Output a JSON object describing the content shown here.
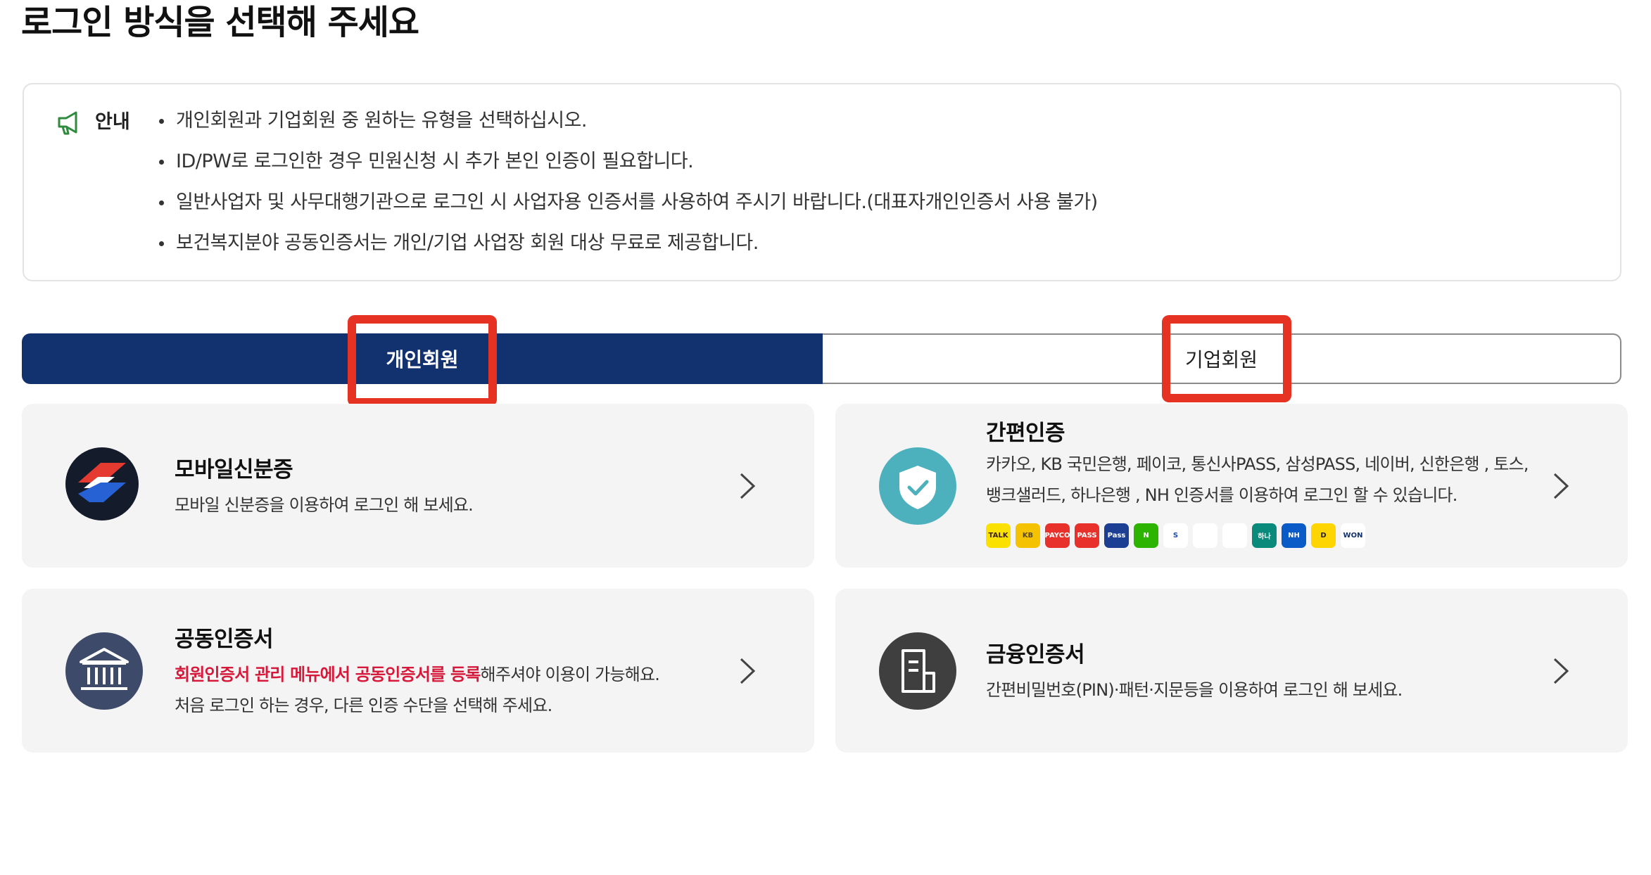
{
  "page": {
    "title": "로그인 방식을 선택해 주세요"
  },
  "notice": {
    "label": "안내",
    "items": [
      "개인회원과 기업회원 중 원하는 유형을 선택하십시오.",
      "ID/PW로 로그인한 경우 민원신청 시 추가 본인 인증이 필요합니다.",
      "일반사업자 및 사무대행기관으로 로그인 시 사업자용 인증서를 사용하여 주시기 바랍니다.(대표자개인인증서 사용 불가)",
      "보건복지분야 공동인증서는 개인/기업 사업장 회원 대상 무료로 제공합니다."
    ]
  },
  "tabs": {
    "personal": "개인회원",
    "business": "기업회원",
    "active": "personal"
  },
  "cards": {
    "mobile_id": {
      "title": "모바일신분증",
      "desc": "모바일 신분증을 이용하여 로그인 해 보세요."
    },
    "simple_auth": {
      "title": "간편인증",
      "desc_line1": "카카오, KB 국민은행, 페이코, 통신사PASS, 삼성PASS, 네이버, 신한은행 , 토스,",
      "desc_line2": "뱅크샐러드, 하나은행 , NH 인증서를 이용하여 로그인 할 수 있습니다.",
      "logos": [
        {
          "text": "TALK",
          "bg": "#fae100",
          "fg": "#3a1d1d"
        },
        {
          "text": "KB",
          "bg": "#f5c200",
          "fg": "#5a4a2a"
        },
        {
          "text": "PAYCO",
          "bg": "#e8312a",
          "fg": "#ffffff"
        },
        {
          "text": "PASS",
          "bg": "#e8312a",
          "fg": "#ffffff"
        },
        {
          "text": "Pass",
          "bg": "#1c3f94",
          "fg": "#ffffff"
        },
        {
          "text": "N",
          "bg": "#2db400",
          "fg": "#ffffff"
        },
        {
          "text": "S",
          "bg": "#ffffff",
          "fg": "#1f4fa6"
        },
        {
          "text": "",
          "bg": "#ffffff",
          "fg": "#1a73e8"
        },
        {
          "text": "",
          "bg": "#ffffff",
          "fg": "#17a673"
        },
        {
          "text": "하나",
          "bg": "#0a8a7a",
          "fg": "#ffffff"
        },
        {
          "text": "NH",
          "bg": "#0a5ac8",
          "fg": "#ffffff"
        },
        {
          "text": "D",
          "bg": "#ffd500",
          "fg": "#222222"
        },
        {
          "text": "WON",
          "bg": "#ffffff",
          "fg": "#12316f"
        }
      ]
    },
    "joint_cert": {
      "title": "공동인증서",
      "desc_red": "회원인증서 관리 메뉴에서 공동인증서를 등록",
      "desc_rest": "해주셔야 이용이 가능해요.",
      "desc_line2": "처음 로그인 하는 경우, 다른 인증 수단을 선택해 주세요."
    },
    "financial_cert": {
      "title": "금융인증서",
      "desc": "간편비밀번호(PIN)·패턴·지문등을 이용하여 로그인 해 보세요."
    }
  }
}
